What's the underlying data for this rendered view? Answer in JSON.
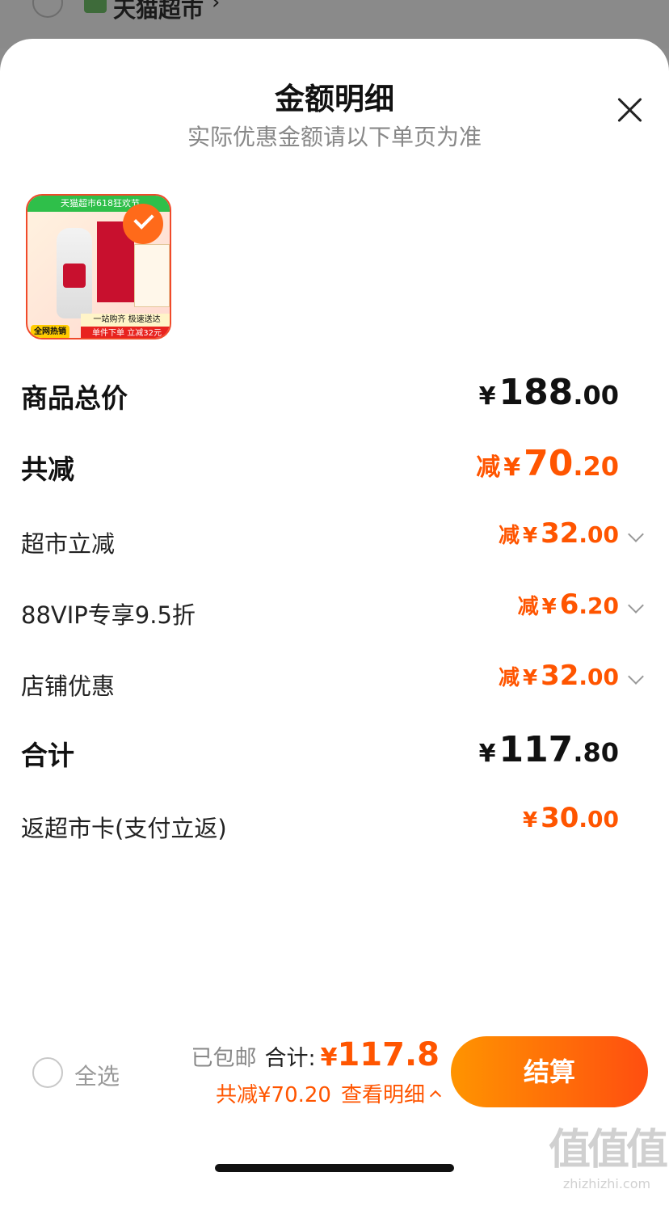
{
  "behind": {
    "store_name": "天猫超市",
    "chevron": "›"
  },
  "sheet": {
    "title": "金额明细",
    "subtitle": "实际优惠金额请以下单页为准"
  },
  "product": {
    "banner": "天猫超市618狂欢节",
    "bar1": "一站购齐 极速送达",
    "bar2": "单件下单 立减32元",
    "tag": "全网热销",
    "selected": true
  },
  "rows": {
    "goods_total": {
      "label": "商品总价",
      "currency": "¥",
      "int": "188",
      "dec": ".00"
    },
    "total_discount": {
      "label": "共减",
      "prefix": "减",
      "currency": "¥",
      "int": "70",
      "dec": ".20"
    },
    "market_discount": {
      "label": "超市立减",
      "prefix": "减",
      "currency": "¥",
      "int": "32",
      "dec": ".00"
    },
    "vip_discount": {
      "label": "88VIP专享9.5折",
      "prefix": "减",
      "currency": "¥",
      "int": "6",
      "dec": ".20"
    },
    "store_discount": {
      "label": "店铺优惠",
      "prefix": "减",
      "currency": "¥",
      "int": "32",
      "dec": ".00"
    },
    "sum": {
      "label": "合计",
      "currency": "¥",
      "int": "117",
      "dec": ".80"
    },
    "cashback": {
      "label": "返超市卡(支付立返)",
      "currency": "¥",
      "int": "30",
      "dec": ".00"
    }
  },
  "bottom": {
    "select_all": "全选",
    "shipping": "已包邮",
    "total_label": "合计:",
    "total_currency": "¥",
    "total_value": "117.8",
    "discount_summary": "共减¥70.20",
    "view_detail": "查看明细",
    "checkout": "结算"
  },
  "watermark": {
    "big": "值值值",
    "small": "zhizhizhi.com"
  },
  "colors": {
    "accent": "#ff5500",
    "checkout_start": "#ff9400",
    "checkout_end": "#ff4e10"
  }
}
